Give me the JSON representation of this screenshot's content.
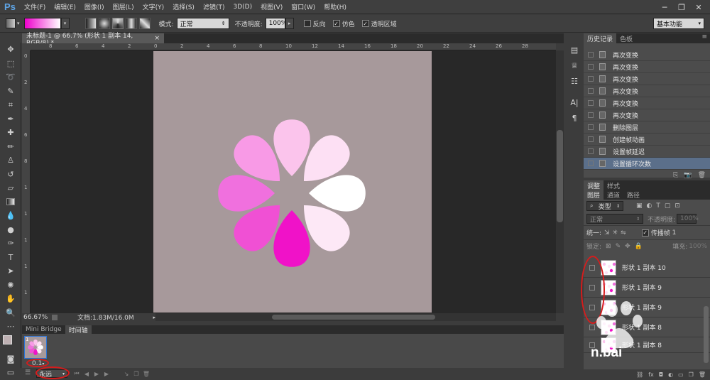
{
  "app": {
    "logo": "Ps"
  },
  "menu": [
    "文件(F)",
    "编辑(E)",
    "图像(I)",
    "图层(L)",
    "文字(Y)",
    "选择(S)",
    "滤镜(T)",
    "3D(D)",
    "视图(V)",
    "窗口(W)",
    "帮助(H)"
  ],
  "options": {
    "mode_label": "模式:",
    "mode_value": "正常",
    "opacity_label": "不透明度:",
    "opacity_value": "100%",
    "reverse": "反向",
    "dither": "仿色",
    "transparency": "透明区域",
    "workspace": "基本功能",
    "gradient_colors": [
      "#ee00cc",
      "#ffffff"
    ]
  },
  "document": {
    "tab_title": "未标题-1 @ 66.7% (形状 1 副本 14, RGB/8) *",
    "zoom": "66.67%",
    "doc_info": "文档:1.83M/16.0M",
    "canvas_color": "#a7999b",
    "ruler_top": [
      "8",
      "6",
      "4",
      "2",
      "0",
      "2",
      "4",
      "6",
      "8",
      "10",
      "12",
      "14",
      "16",
      "18",
      "20",
      "22",
      "24",
      "26",
      "28"
    ],
    "ruler_left": [
      "0",
      "2",
      "4",
      "6",
      "8",
      "1",
      "1",
      "1",
      "1",
      "1"
    ]
  },
  "flower": {
    "petal_colors": [
      "#fbc4ec",
      "#fde0f4",
      "#ffffff",
      "#fde8f6",
      "#f012c8",
      "#f050d4",
      "#f070de",
      "#f89ae6"
    ]
  },
  "bottom_tabs": {
    "bridge": "Mini Bridge",
    "timeline": "时间轴"
  },
  "timeline": {
    "frame_number": "1",
    "frame_delay": "0.1",
    "loop": "永远"
  },
  "history": {
    "tabs": [
      "历史记录",
      "色板"
    ],
    "items": [
      "再次变换",
      "再次变换",
      "再次变换",
      "再次变换",
      "再次变换",
      "再次变换",
      "删除图层",
      "创建帧动画",
      "设置帧延迟",
      "设置循环次数"
    ]
  },
  "adjust_tabs": [
    "调整",
    "样式"
  ],
  "layers": {
    "tabs": [
      "图层",
      "通道",
      "路径"
    ],
    "kind_label": "类型",
    "blend_mode": "正常",
    "opacity_label": "不透明度:",
    "opacity_value": "100%",
    "unify_label": "统一:",
    "propagate_label": "传播帧",
    "propagate_value": "1",
    "lock_label": "锁定:",
    "fill_label": "填充:",
    "fill_value": "100%",
    "rows": [
      "形状 1 副本 10",
      "形状 1 副本 9",
      "形状 1 副本 9",
      "形状 1 副本 8",
      "形状 1 副本 8"
    ]
  },
  "watermark": "n.bai"
}
